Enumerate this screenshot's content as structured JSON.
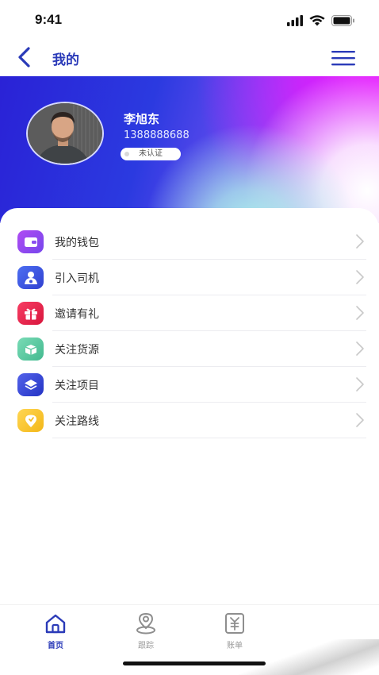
{
  "status_bar": {
    "time": "9:41"
  },
  "nav": {
    "title": "我的"
  },
  "profile": {
    "name": "李旭东",
    "phone": "1388888688",
    "badge": "未认证"
  },
  "menu_items": [
    {
      "label": "我的钱包",
      "icon": "wallet-icon",
      "color": "#8a4ff0"
    },
    {
      "label": "引入司机",
      "icon": "driver-icon",
      "color": "#3b4fd8"
    },
    {
      "label": "邀请有礼",
      "icon": "gift-icon",
      "color": "#e8244e"
    },
    {
      "label": "关注货源",
      "icon": "cargo-icon",
      "color": "#5cc8a0"
    },
    {
      "label": "关注项目",
      "icon": "layers-icon",
      "color": "#3346d6"
    },
    {
      "label": "关注路线",
      "icon": "route-pin-icon",
      "color": "#f7c531"
    }
  ],
  "tabbar": {
    "tabs": [
      {
        "label": "首页",
        "icon": "home-icon",
        "active": true
      },
      {
        "label": "跟踪",
        "icon": "tracking-icon",
        "active": false
      },
      {
        "label": "账单",
        "icon": "bill-icon",
        "active": false
      }
    ]
  },
  "colors": {
    "accent": "#2a3ab8"
  }
}
